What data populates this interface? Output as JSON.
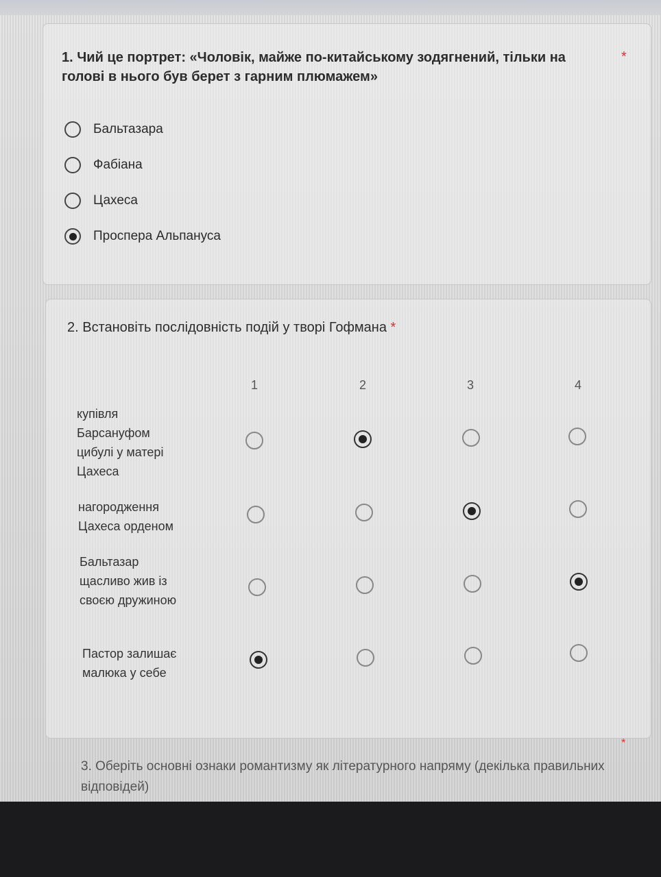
{
  "question1": {
    "title": "1. Чий це портрет: «Чоловік, майже по-китайському зодягнений, тільки на голові в нього був берет з гарним плюмажем»",
    "required_mark": "*",
    "options": [
      {
        "label": "Бальтазара",
        "selected": false
      },
      {
        "label": "Фабіана",
        "selected": false
      },
      {
        "label": "Цахеса",
        "selected": false
      },
      {
        "label": "Проспера Альпануса",
        "selected": true
      }
    ]
  },
  "question2": {
    "title": "2. Встановіть послідовність подій у творі Гофмана",
    "required_mark": "*",
    "columns": [
      "1",
      "2",
      "3",
      "4"
    ],
    "rows": [
      {
        "label": "купівля Барсануфом цибулі у матері Цахеса",
        "selected_column": 2
      },
      {
        "label": "нагородження Цахеса орденом",
        "selected_column": 3
      },
      {
        "label": "Бальтазар щасливо жив із своєю дружиною",
        "selected_column": 4
      },
      {
        "label": "Пастор залишає малюка у себе",
        "selected_column": 1
      }
    ]
  },
  "question3": {
    "title": "3. Оберіть основні ознаки романтизму як літературного напряму (декілька правильних відповідей)",
    "required_mark": "*"
  },
  "colors": {
    "required": "#dd3333",
    "text": "#2c2c2c",
    "header_accent": "#6f86b8"
  }
}
